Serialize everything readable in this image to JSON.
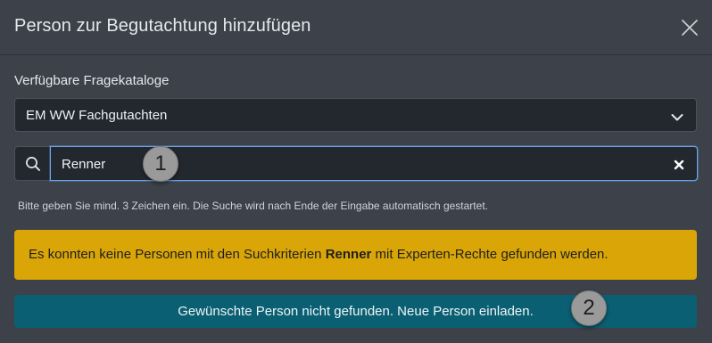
{
  "dialog": {
    "title": "Person zur Begutachtung hinzufügen"
  },
  "catalog": {
    "label": "Verfügbare Fragekataloge",
    "selected": "EM WW Fachgutachten"
  },
  "search": {
    "value": "Renner",
    "hint": "Bitte geben Sie mind. 3 Zeichen ein. Die Suche wird nach Ende der Eingabe automatisch gestartet."
  },
  "alert": {
    "text_before": "Es konnten keine Personen mit den Suchkriterien ",
    "term": "Renner",
    "text_after": " mit Experten-Rechte gefunden werden.",
    "color": "#d9a507"
  },
  "invite_button": {
    "label": "Gewünschte Person nicht gefunden. Neue Person einladen.",
    "color": "#0b5f73"
  },
  "markers": [
    "1",
    "2"
  ],
  "icons": {
    "close": "close-icon",
    "chevron": "chevron-down-icon",
    "search": "search-icon",
    "clear": "clear-icon"
  }
}
